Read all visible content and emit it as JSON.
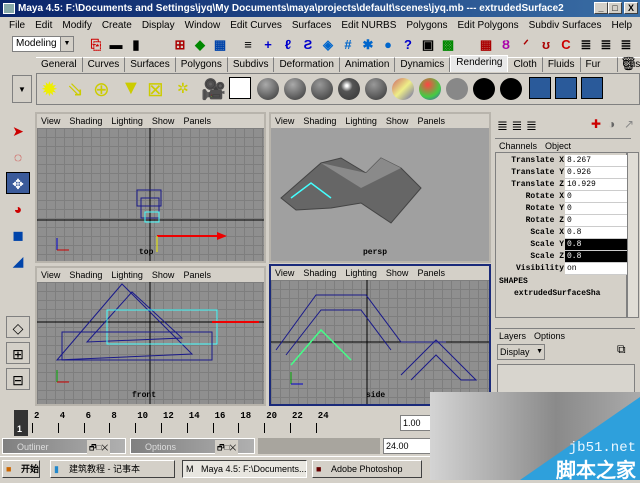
{
  "title": "Maya 4.5: F:\\Documents and Settings\\jyq\\My Documents\\maya\\projects\\default\\scenes\\jyq.mb  ---  extrudedSurface2",
  "window_buttons": {
    "minimize": "_",
    "maximize": "□",
    "close": "X"
  },
  "menu": [
    "File",
    "Edit",
    "Modify",
    "Create",
    "Display",
    "Window",
    "Edit Curves",
    "Surfaces",
    "Edit NURBS",
    "Polygons",
    "Edit Polygons",
    "Subdiv Surfaces",
    "Help"
  ],
  "mode_select": "Modeling",
  "shelf_tabs": [
    "General",
    "Curves",
    "Surfaces",
    "Polygons",
    "Subdivs",
    "Deformation",
    "Animation",
    "Dynamics",
    "Rendering",
    "Cloth",
    "Fluids",
    "Fur",
    "Custom"
  ],
  "active_shelf_tab": "Rendering",
  "viewport_menu": [
    "View",
    "Shading",
    "Lighting",
    "Show",
    "Panels"
  ],
  "viewports": {
    "top": "top",
    "persp": "persp",
    "front": "front",
    "side": "side"
  },
  "channel_box": {
    "menu": [
      "Channels",
      "Object"
    ],
    "rows": [
      {
        "label": "Translate X",
        "value": "8.267"
      },
      {
        "label": "Translate Y",
        "value": "0.926"
      },
      {
        "label": "Translate Z",
        "value": "10.929"
      },
      {
        "label": "Rotate X",
        "value": "0"
      },
      {
        "label": "Rotate Y",
        "value": "0"
      },
      {
        "label": "Rotate Z",
        "value": "0"
      },
      {
        "label": "Scale X",
        "value": "0.8"
      },
      {
        "label": "Scale Y",
        "value": "0.8"
      },
      {
        "label": "Scale Z",
        "value": "0.8"
      },
      {
        "label": "Visibility",
        "value": "on"
      }
    ],
    "shapes_header": "SHAPES",
    "shape_name": "extrudedSurfaceSha"
  },
  "layers": {
    "menu": [
      "Layers",
      "Options"
    ],
    "display_select": "Display"
  },
  "timeline": {
    "current_frame": "1",
    "ticks": [
      "2",
      "4",
      "6",
      "8",
      "10",
      "12",
      "14",
      "16",
      "18",
      "20",
      "22",
      "24"
    ],
    "start_field": "1.00",
    "end_field": "24.00"
  },
  "mini_windows": [
    "Outliner",
    "Options"
  ],
  "taskbar": {
    "start": "开始",
    "tasks": [
      "建筑教程 - 记事本",
      "Maya 4.5: F:\\Documents...",
      "Adobe Photoshop"
    ]
  },
  "watermark": {
    "site": "jb51.net",
    "name": "脚本之家"
  }
}
